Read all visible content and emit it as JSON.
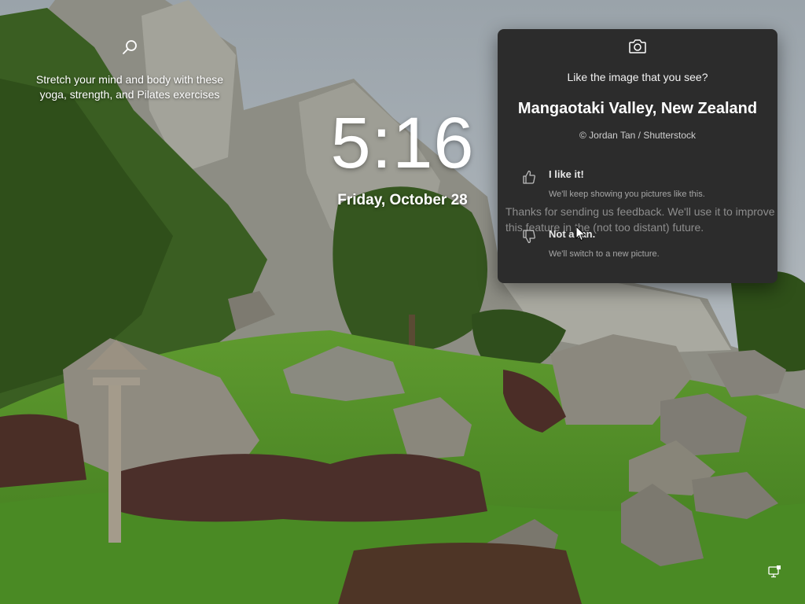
{
  "lockscreen": {
    "tip": {
      "icon": "search-icon",
      "text": "Stretch your mind and body with these yoga, strength, and Pilates exercises"
    },
    "clock": {
      "time": "5:16",
      "date": "Friday, October 28"
    },
    "spotlight": {
      "icon": "camera-icon",
      "question": "Like the image that you see?",
      "title": "Mangaotaki Valley, New Zealand",
      "credit": "© Jordan Tan / Shutterstock",
      "options": [
        {
          "icon": "thumbs-up-icon",
          "label": "I like it!",
          "description": "We'll keep showing you pictures like this."
        },
        {
          "icon": "thumbs-down-icon",
          "label": "Not a fan.",
          "description": "We'll switch to a new picture."
        }
      ],
      "feedback_message": "Thanks for sending us feedback. We'll use it to improve this feature in the (not too distant) future."
    },
    "tray": {
      "icon": "network-icon"
    },
    "colors": {
      "flyout_bg": "#2c2c2c",
      "text": "#ffffff",
      "muted": "#a6a6a6"
    }
  }
}
